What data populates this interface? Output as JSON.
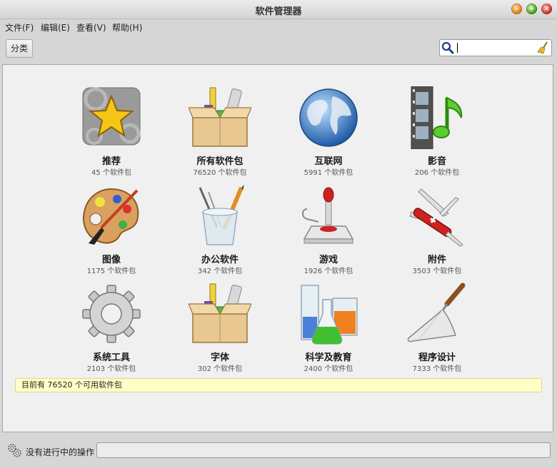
{
  "window": {
    "title": "软件管理器"
  },
  "menu": [
    {
      "label": "文件(F)"
    },
    {
      "label": "编辑(E)"
    },
    {
      "label": "查看(V)"
    },
    {
      "label": "帮助(H)"
    }
  ],
  "toolbar": {
    "category_label": "分类",
    "search_value": "",
    "search_icon": "magnifier-icon",
    "clear_icon": "broom-icon"
  },
  "categories": [
    {
      "name": "推荐",
      "count": "45 个软件包",
      "icon": "featured-star-icon"
    },
    {
      "name": "所有软件包",
      "count": "76520 个软件包",
      "icon": "package-box-icon"
    },
    {
      "name": "互联网",
      "count": "5991 个软件包",
      "icon": "globe-icon"
    },
    {
      "name": "影音",
      "count": "206 个软件包",
      "icon": "film-music-icon"
    },
    {
      "name": "图像",
      "count": "1175 个软件包",
      "icon": "paint-palette-icon"
    },
    {
      "name": "办公软件",
      "count": "342 个软件包",
      "icon": "pencil-cup-icon"
    },
    {
      "name": "游戏",
      "count": "1926 个软件包",
      "icon": "joystick-icon"
    },
    {
      "name": "附件",
      "count": "3503 个软件包",
      "icon": "swiss-knife-icon"
    },
    {
      "name": "系统工具",
      "count": "2103 个软件包",
      "icon": "gear-icon"
    },
    {
      "name": "字体",
      "count": "302 个软件包",
      "icon": "package-box-icon"
    },
    {
      "name": "科学及教育",
      "count": "2400 个软件包",
      "icon": "lab-flasks-icon"
    },
    {
      "name": "程序设计",
      "count": "7333 个软件包",
      "icon": "trowel-icon"
    }
  ],
  "status_message": "目前有 76520 个可用软件包",
  "bottom": {
    "operations_label": "没有进行中的操作",
    "operations_icon": "gears-icon"
  },
  "colors": {
    "status_bg": "#ffffc8",
    "content_bg": "#f0f0f0"
  }
}
